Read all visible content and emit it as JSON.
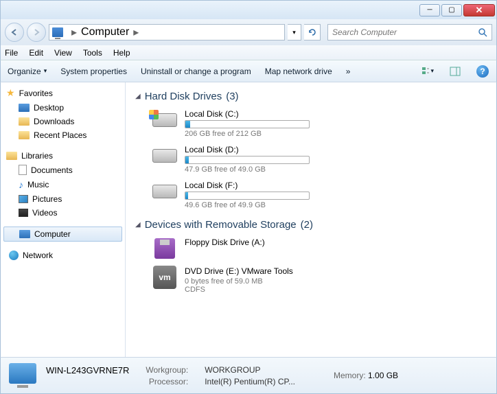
{
  "titlebar": {
    "min": "─",
    "max": "▢",
    "close": "✕"
  },
  "nav": {
    "location": "Computer",
    "arrow": "▸",
    "search_placeholder": "Search Computer"
  },
  "menu": [
    "File",
    "Edit",
    "View",
    "Tools",
    "Help"
  ],
  "toolbar": {
    "organize": "Organize",
    "sysprops": "System properties",
    "uninstall": "Uninstall or change a program",
    "mapdrive": "Map network drive",
    "overflow": "»"
  },
  "sidebar": {
    "favorites": {
      "label": "Favorites",
      "items": [
        "Desktop",
        "Downloads",
        "Recent Places"
      ]
    },
    "libraries": {
      "label": "Libraries",
      "items": [
        "Documents",
        "Music",
        "Pictures",
        "Videos"
      ]
    },
    "computer": {
      "label": "Computer"
    },
    "network": {
      "label": "Network"
    }
  },
  "sections": {
    "hdd": {
      "title": "Hard Disk Drives",
      "count": "(3)"
    },
    "removable": {
      "title": "Devices with Removable Storage",
      "count": "(2)"
    }
  },
  "drives": {
    "c": {
      "name": "Local Disk (C:)",
      "free": "206 GB free of 212 GB",
      "fill_pct": 4
    },
    "d": {
      "name": "Local Disk (D:)",
      "free": "47.9 GB free of 49.0 GB",
      "fill_pct": 3
    },
    "f": {
      "name": "Local Disk (F:)",
      "free": "49.6 GB free of 49.9 GB",
      "fill_pct": 2
    },
    "a": {
      "name": "Floppy Disk Drive (A:)"
    },
    "e": {
      "name": "DVD Drive (E:) VMware Tools",
      "free": "0 bytes free of 59.0 MB",
      "fs": "CDFS"
    }
  },
  "details": {
    "name": "WIN-L243GVRNE7R",
    "workgroup_lbl": "Workgroup:",
    "workgroup": "WORKGROUP",
    "memory_lbl": "Memory:",
    "memory": "1.00 GB",
    "processor_lbl": "Processor:",
    "processor": "Intel(R) Pentium(R) CP..."
  }
}
